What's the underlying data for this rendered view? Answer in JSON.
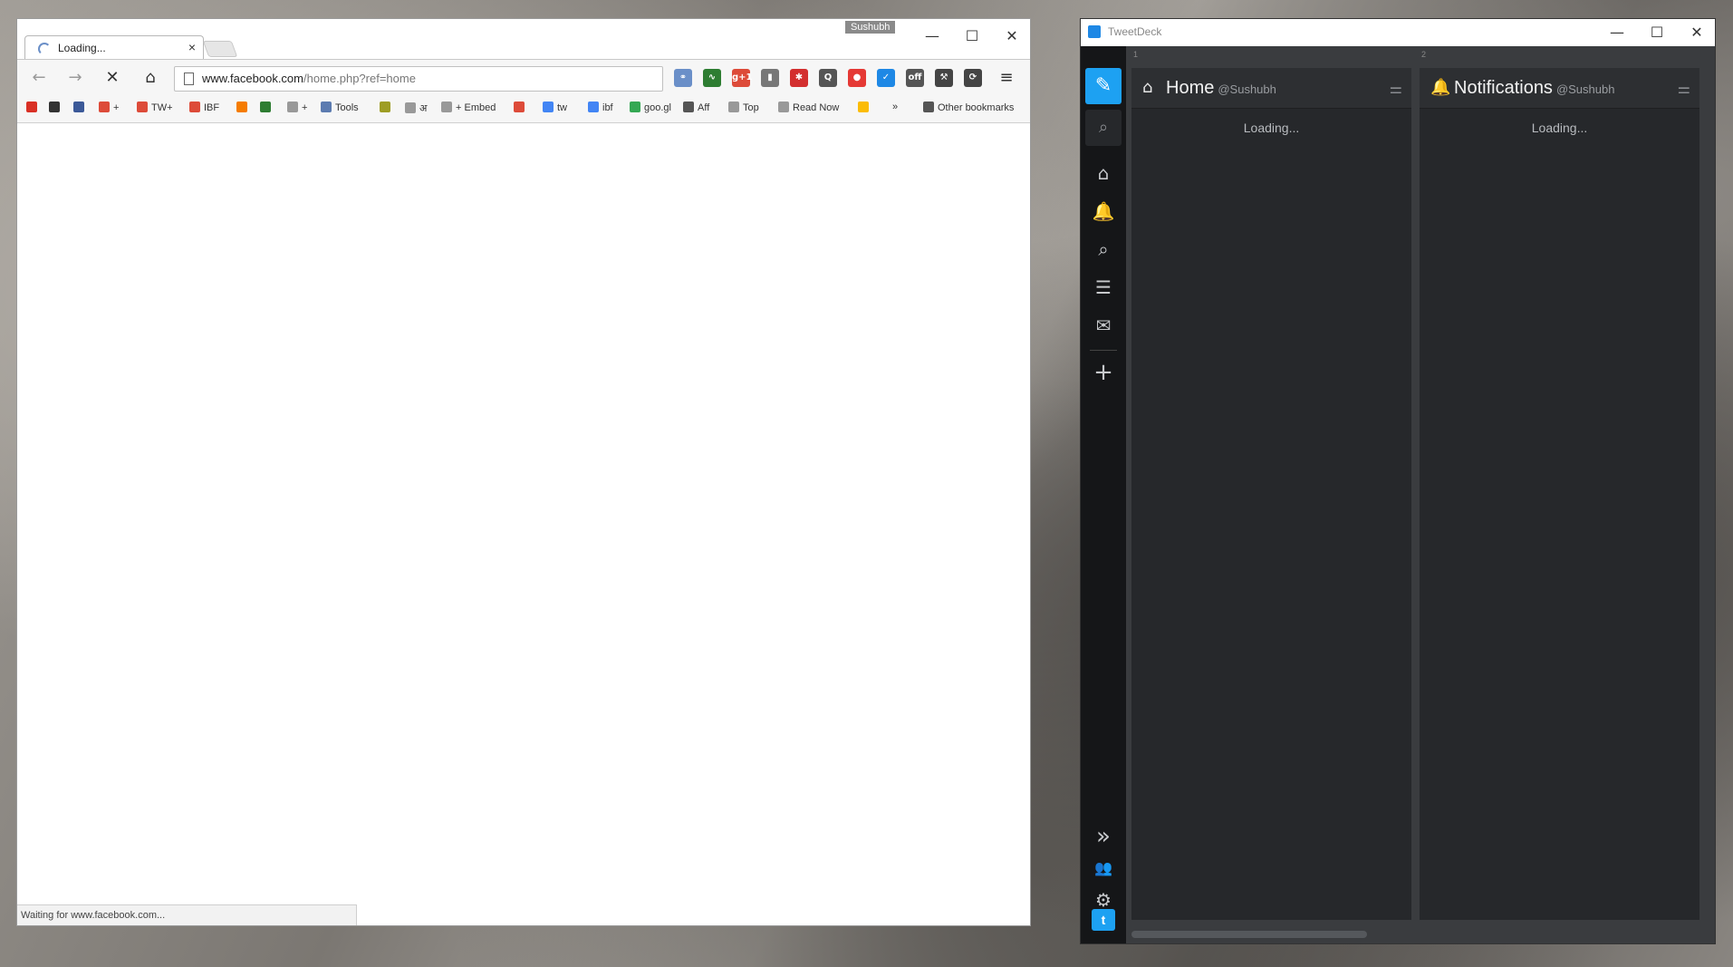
{
  "chrome": {
    "profile_name": "Sushubh",
    "tab_title": "Loading...",
    "tab_close": "×",
    "url_host": "www.facebook.com",
    "url_path": "/home.php?ref=home",
    "status_text": "Waiting for www.facebook.com...",
    "window_buttons": {
      "minimize": "—",
      "maximize": "☐",
      "close": "✕"
    },
    "nav": {
      "back": "←",
      "forward": "→",
      "stop": "✕",
      "home": "⌂",
      "menu": "≡"
    },
    "extensions": [
      {
        "name": "link-extension-icon",
        "glyph": "⚭",
        "color": "#6a8fc8"
      },
      {
        "name": "activity-extension-icon",
        "glyph": "∿",
        "color": "#2e7d32"
      },
      {
        "name": "google-plus-one-icon",
        "glyph": "g+1",
        "color": "#dd4b39"
      },
      {
        "name": "bookmark-extension-icon",
        "glyph": "▮",
        "color": "#777777"
      },
      {
        "name": "red-badge-extension-icon",
        "glyph": "✱",
        "color": "#d32f2f"
      },
      {
        "name": "q-extension-icon",
        "glyph": "Q",
        "color": "#555555"
      },
      {
        "name": "red-circle-extension-icon",
        "glyph": "●",
        "color": "#e53935"
      },
      {
        "name": "blue-check-extension-icon",
        "glyph": "✓",
        "color": "#1e88e5"
      },
      {
        "name": "off-extension-icon",
        "glyph": "off",
        "color": "#555555"
      },
      {
        "name": "tools-extension-icon",
        "glyph": "⚒",
        "color": "#444444"
      },
      {
        "name": "sync-extension-icon",
        "glyph": "⟳",
        "color": "#444444"
      }
    ],
    "bookmarks": [
      {
        "label": "",
        "name": "gmail-bookmark",
        "color": "#d93025"
      },
      {
        "label": "",
        "name": "ibf-bookmark",
        "color": "#333333"
      },
      {
        "label": "",
        "name": "facebook-bookmark",
        "color": "#3b5998"
      },
      {
        "label": "+",
        "name": "gplus-bookmark",
        "color": "#dd4b39"
      },
      {
        "label": "TW+",
        "name": "tw-plus-bookmark",
        "color": "#dd4b39"
      },
      {
        "label": "IBF",
        "name": "ibf-g-bookmark",
        "color": "#dd4b39"
      },
      {
        "label": "",
        "name": "chart-bookmark",
        "color": "#f57c00"
      },
      {
        "label": "",
        "name": "green-bookmark",
        "color": "#2e7d32"
      },
      {
        "label": "+",
        "name": "page-plus-bookmark",
        "color": "#999999"
      },
      {
        "label": "Tools",
        "name": "tools-bookmark",
        "color": "#5c7bb0"
      },
      {
        "label": "",
        "name": "tw-bookmark",
        "color": "#9e9d24"
      },
      {
        "label": "अ",
        "name": "hindi-bookmark",
        "color": "#999999"
      },
      {
        "label": "+ Embed",
        "name": "embed-bookmark",
        "color": "#999999"
      },
      {
        "label": "",
        "name": "g-red-bookmark",
        "color": "#dd4b39"
      },
      {
        "label": "tw",
        "name": "google-tw-bookmark",
        "color": "#4285f4"
      },
      {
        "label": "ibf",
        "name": "google-ibf-bookmark",
        "color": "#4285f4"
      },
      {
        "label": "goo.gl",
        "name": "googl-bookmark",
        "color": "#34a853"
      },
      {
        "label": "Aff",
        "name": "aff-folder-bookmark",
        "color": "#555555"
      },
      {
        "label": "Top",
        "name": "top-bookmark",
        "color": "#999999"
      },
      {
        "label": "Read Now",
        "name": "read-now-bookmark",
        "color": "#999999"
      },
      {
        "label": "",
        "name": "drive-bookmark",
        "color": "#fbbc05"
      },
      {
        "label": "»",
        "name": "more-bookmarks",
        "color": ""
      },
      {
        "label": "Other bookmarks",
        "name": "other-bookmarks-folder",
        "color": "#555555"
      }
    ]
  },
  "tweetdeck": {
    "window_title": "TweetDeck",
    "window_buttons": {
      "minimize": "—",
      "maximize": "☐",
      "close": "✕"
    },
    "nav": {
      "compose": "✎",
      "search": "⌕",
      "home": "⌂",
      "notifications": "🔔",
      "search2": "⌕",
      "lists": "☰",
      "messages": "✉",
      "add_column": "+",
      "expand": "»",
      "accounts": "👥",
      "settings": "⚙",
      "twitter": "t"
    },
    "columns": [
      {
        "num": "1",
        "icon": "⌂",
        "title": "Home",
        "user": "@Sushubh",
        "loading": "Loading..."
      },
      {
        "num": "2",
        "icon": "🔔",
        "title": "Notifications",
        "user": "@Sushubh",
        "loading": "Loading..."
      }
    ],
    "column_options": "⚌",
    "colors": {
      "accent": "#1da1f2",
      "bg": "#151618",
      "column": "#26282b"
    }
  }
}
